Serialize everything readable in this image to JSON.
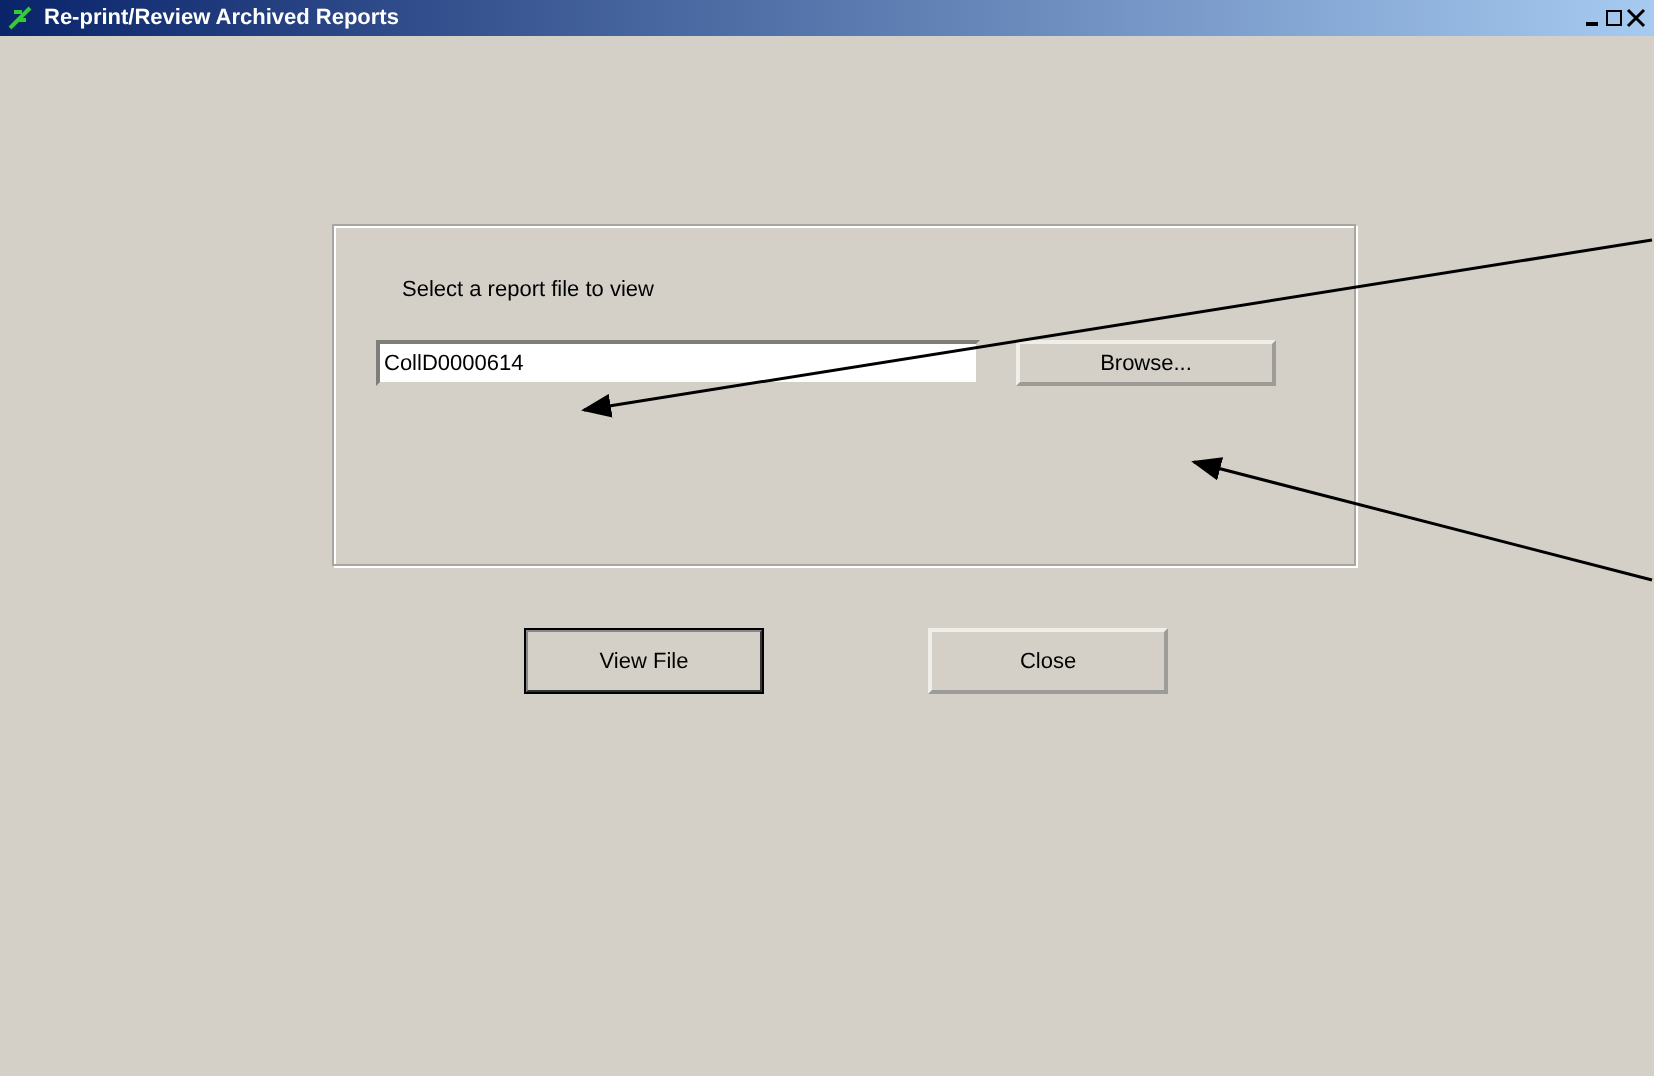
{
  "window": {
    "title": "Re-print/Review Archived Reports"
  },
  "group": {
    "label": "Select a report file to view",
    "field": {
      "value": "CollD0000614"
    },
    "browse_button": "Browse..."
  },
  "buttons": [
    {
      "label": "View File",
      "default": true
    },
    {
      "label": "Close",
      "default": false
    }
  ],
  "annotations": [
    {
      "kind": "arrow"
    },
    {
      "kind": "arrow"
    }
  ]
}
